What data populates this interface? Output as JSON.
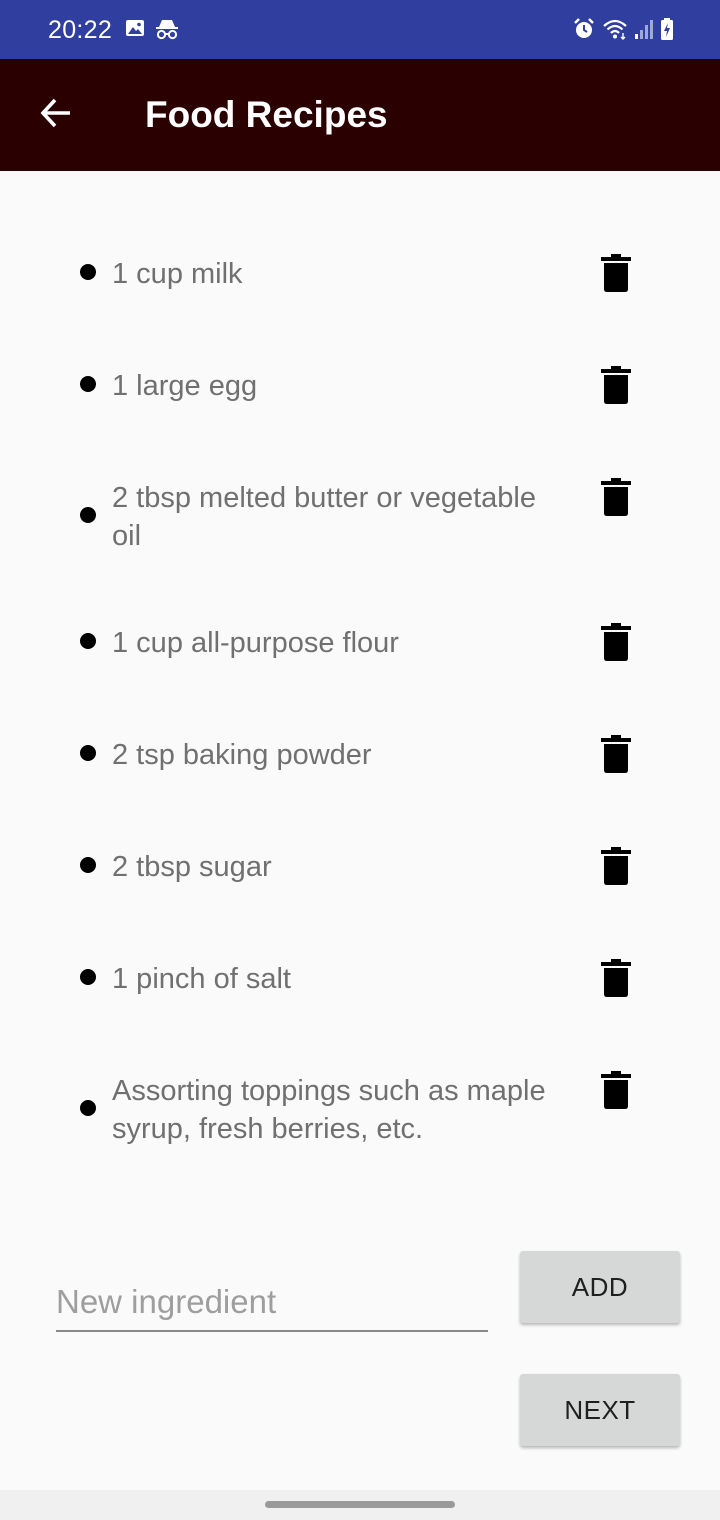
{
  "status_bar": {
    "time": "20:22",
    "left_icons": [
      "image-icon",
      "incognito-icon"
    ],
    "right_icons": [
      "alarm-icon",
      "wifi-icon",
      "signal-icon",
      "battery-charging-icon"
    ]
  },
  "app_bar": {
    "title": "Food Recipes",
    "back_icon": "arrow-left-icon"
  },
  "ingredients": [
    {
      "text": "1 cup milk"
    },
    {
      "text": "1 large egg"
    },
    {
      "text": "2 tbsp melted butter or vegetable oil"
    },
    {
      "text": "1 cup all-purpose flour"
    },
    {
      "text": "2 tsp baking powder"
    },
    {
      "text": "2 tbsp sugar"
    },
    {
      "text": "1 pinch of salt"
    },
    {
      "text": "Assorting toppings such as maple syrup, fresh berries, etc."
    }
  ],
  "new_ingredient": {
    "value": "",
    "placeholder": "New ingredient"
  },
  "buttons": {
    "add_label": "ADD",
    "next_label": "NEXT"
  },
  "colors": {
    "status_bar": "#303f9f",
    "app_bar": "#2a0000",
    "background": "#fafafa",
    "button": "#d6d7d7",
    "ingredient_text": "#707070"
  }
}
